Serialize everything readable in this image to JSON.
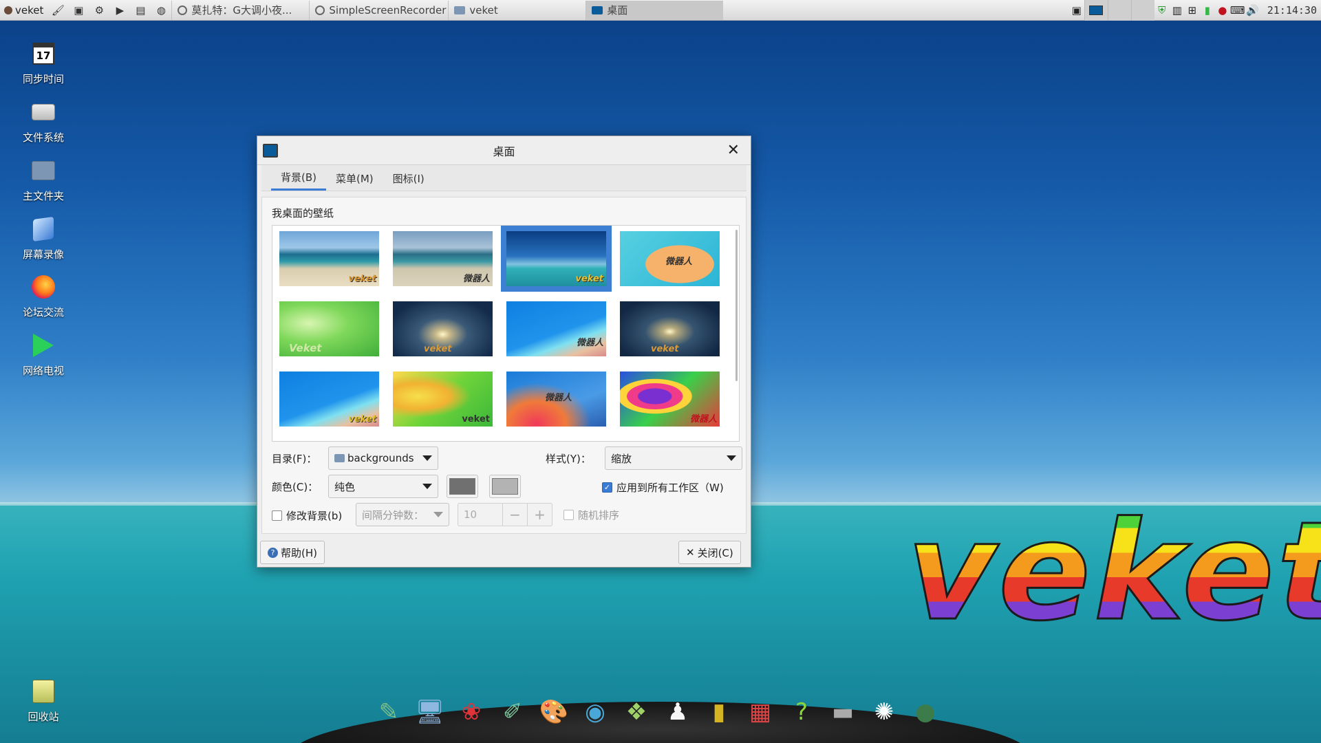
{
  "taskbar": {
    "start_label": "veket",
    "tasks": [
      {
        "label": "莫扎特：G大调小夜...",
        "active": false
      },
      {
        "label": "SimpleScreenRecorder",
        "active": false
      },
      {
        "label": "veket",
        "active": false
      },
      {
        "label": "桌面",
        "active": true
      }
    ],
    "clock": "21:14:30"
  },
  "desktop_icons": [
    {
      "label": "同步时间",
      "icon": "calendar-icon",
      "day": "17"
    },
    {
      "label": "文件系统",
      "icon": "drive-icon"
    },
    {
      "label": "主文件夹",
      "icon": "home-folder-icon"
    },
    {
      "label": "屏幕录像",
      "icon": "screen-record-icon"
    },
    {
      "label": "论坛交流",
      "icon": "firefox-icon"
    },
    {
      "label": "网络电视",
      "icon": "play-icon"
    },
    {
      "label": "回收站",
      "icon": "trash-icon"
    }
  ],
  "dialog": {
    "title": "桌面",
    "tabs": [
      "背景(B)",
      "菜单(M)",
      "图标(I)"
    ],
    "active_tab": 0,
    "wallpaper_label": "我桌面的壁纸",
    "thumbnails": [
      {
        "watermark": "veket",
        "style": "beach"
      },
      {
        "watermark": "微器人",
        "style": "beach2"
      },
      {
        "watermark": "veket",
        "style": "ocean",
        "selected": true
      },
      {
        "watermark": "微器人",
        "style": "peach"
      },
      {
        "watermark": "Veket",
        "style": "green"
      },
      {
        "watermark": "veket",
        "style": "sunset"
      },
      {
        "watermark": "微器人",
        "style": "blue"
      },
      {
        "watermark": "veket",
        "style": "sunset2"
      },
      {
        "watermark": "veket",
        "style": "blue2"
      },
      {
        "watermark": "veket",
        "style": "yellowgreen"
      },
      {
        "watermark": "微器人",
        "style": "redblue"
      },
      {
        "watermark": "微器人",
        "style": "rainbow"
      }
    ],
    "dir_label": "目录(F)：",
    "dir_value": "backgrounds",
    "style_label": "样式(Y)：",
    "style_value": "缩放",
    "color_label": "颜色(C)：",
    "color_value": "纯色",
    "color1": "#707070",
    "color2": "#b3b3b3",
    "apply_all_label": "应用到所有工作区（W)",
    "apply_all_checked": true,
    "change_bg_label": "修改背景(b)",
    "interval_label": "间隔分钟数：",
    "interval_value": "10",
    "random_label": "随机排序",
    "help_label": "帮助(H)",
    "close_label": "关闭(C)"
  },
  "brand_text": "veket"
}
